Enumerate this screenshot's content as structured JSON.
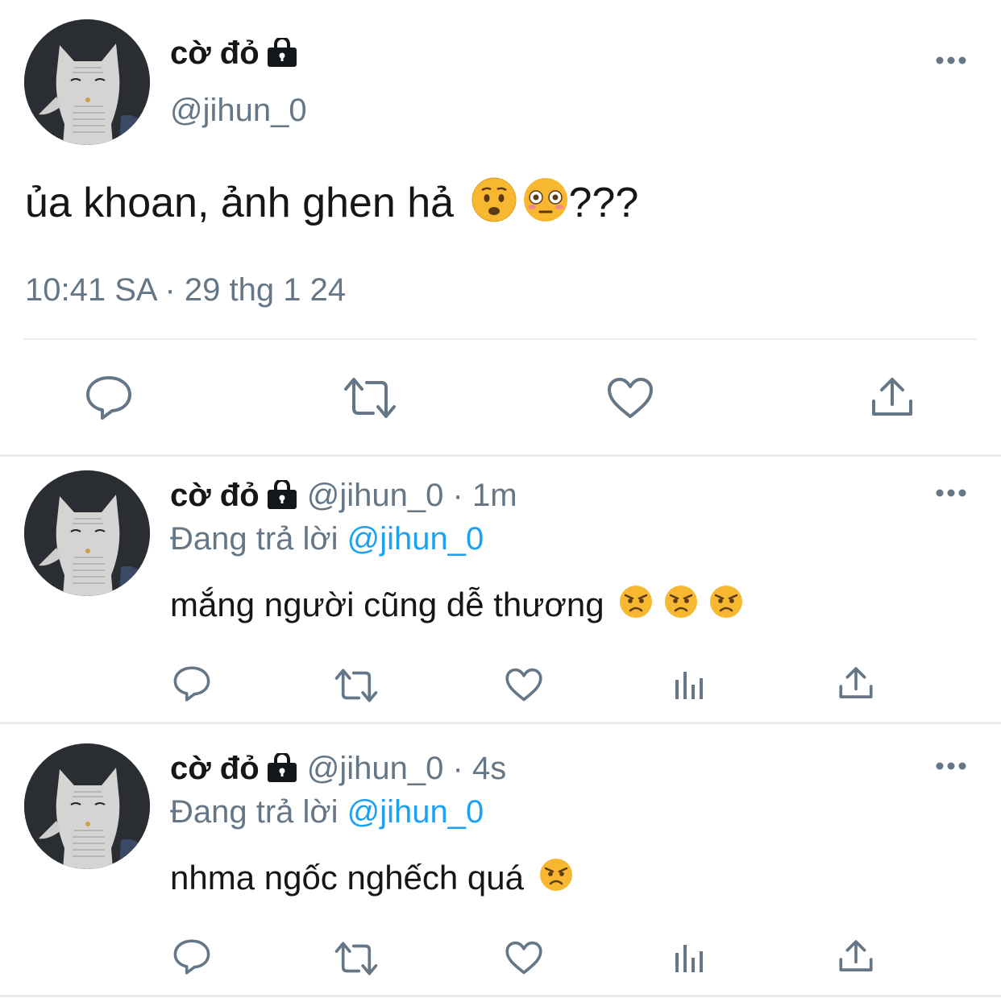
{
  "main_tweet": {
    "display_name": "cờ đỏ",
    "handle": "@jihun_0",
    "text": "ủa khoan, ảnh ghen hả",
    "text_suffix": "???",
    "emojis": [
      "worried-face",
      "flushed-face"
    ],
    "timestamp": "10:41 SA · 29 thg 1 24",
    "more_icon": "more-horizontal-icon",
    "actions": [
      "reply-icon",
      "retweet-icon",
      "like-icon",
      "share-icon"
    ]
  },
  "replies": [
    {
      "display_name": "cờ đỏ",
      "handle_time": "@jihun_0 · 1m",
      "replying_label": "Đang trả lời",
      "replying_to": "@jihun_0",
      "text": "mắng người cũng dễ thương",
      "emojis": [
        "angry-face",
        "angry-face",
        "angry-face"
      ],
      "actions": [
        "reply-icon",
        "retweet-icon",
        "like-icon",
        "analytics-icon",
        "share-icon"
      ]
    },
    {
      "display_name": "cờ đỏ",
      "handle_time": "@jihun_0 · 4s",
      "replying_label": "Đang trả lời",
      "replying_to": "@jihun_0",
      "text": "nhma ngốc nghếch quá",
      "emojis": [
        "angry-face"
      ],
      "actions": [
        "reply-icon",
        "retweet-icon",
        "like-icon",
        "analytics-icon",
        "share-icon"
      ]
    }
  ],
  "colors": {
    "text": "#14171a",
    "secondary": "#657786",
    "link": "#1da1f2",
    "divider": "#e6ecf0",
    "icon": "#657786"
  }
}
